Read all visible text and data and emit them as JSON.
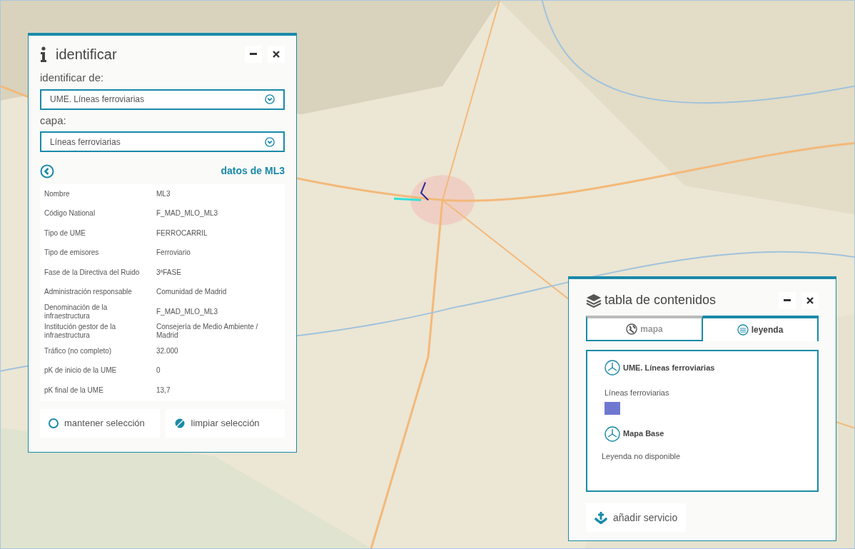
{
  "identify_panel": {
    "title": "identificar",
    "source_label": "identificar de:",
    "source_value": "UME. Líneas ferroviarias",
    "layer_label": "capa:",
    "layer_value": "Líneas ferroviarias",
    "details_title": "datos de ML3",
    "rows": [
      {
        "name": "Nombre",
        "value": "ML3"
      },
      {
        "name": "Código National",
        "value": "F_MAD_MLO_ML3"
      },
      {
        "name": "Tipo de UME",
        "value": "FERROCARRIL"
      },
      {
        "name": "Tipo de emisores",
        "value": "Ferroviario"
      },
      {
        "name": "Fase de la Directiva del Ruido",
        "value": "3ªFASE"
      },
      {
        "name": "Administración responsable",
        "value": "Comunidad de Madrid"
      },
      {
        "name": "Denominación de la infraestructura",
        "value": "F_MAD_MLO_ML3"
      },
      {
        "name": "Institución gestor de la infraestructura",
        "value": "Consejería de Medio Ambiente / Madrid"
      },
      {
        "name": "Tráfico (no completo)",
        "value": "32.000"
      },
      {
        "name": "pK de inicio de la UME",
        "value": "0"
      },
      {
        "name": "pK final de la UME",
        "value": "13,7"
      }
    ],
    "keep_selection": {
      "label": "mantener selección",
      "checked": false
    },
    "clear_selection": "limpiar selección"
  },
  "contents_panel": {
    "title": "tabla de contenidos",
    "tabs": [
      {
        "label": "mapa",
        "selected": false,
        "kind": "map"
      },
      {
        "label": "leyenda",
        "selected": true,
        "kind": "legend"
      }
    ],
    "layers": [
      {
        "name": "UME. Líneas ferroviarias",
        "entries": [
          {
            "label": "Líneas ferroviarias",
            "color": "#6f78d0"
          }
        ]
      },
      {
        "name": "Mapa Base",
        "note": "Leyenda no disponible"
      }
    ],
    "add_service": "añadir servicio"
  }
}
